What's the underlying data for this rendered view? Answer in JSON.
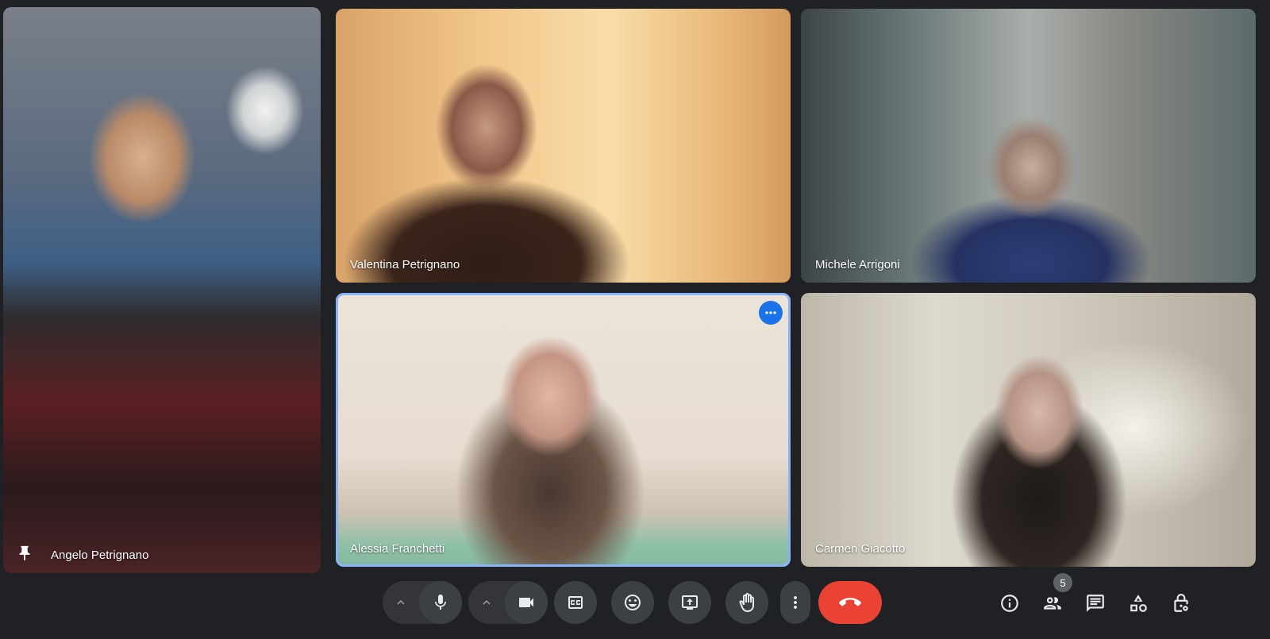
{
  "participants": [
    {
      "name": "Angelo Petrignano"
    },
    {
      "name": "Valentina Petrignano"
    },
    {
      "name": "Michele Arrigoni"
    },
    {
      "name": "Alessia Franchetti"
    },
    {
      "name": "Carmen Giacotto"
    }
  ],
  "participants_count": "5",
  "colors": {
    "background": "#202124",
    "control": "#3c4043",
    "end_call": "#ea4335",
    "active_outline": "#8ab4f8",
    "more_button": "#1a73e8"
  },
  "icons": {
    "pin": "pin-icon",
    "more": "more-horiz-icon",
    "mic": "mic-icon",
    "camera": "videocam-icon",
    "captions": "closed-caption-icon",
    "reactions": "emoji-icon",
    "present": "present-screen-icon",
    "raise_hand": "raise-hand-icon",
    "more_options": "more-vert-icon",
    "end_call": "call-end-icon",
    "info": "info-icon",
    "people": "people-icon",
    "chat": "chat-icon",
    "activities": "activities-icon",
    "host_controls": "host-controls-icon"
  }
}
